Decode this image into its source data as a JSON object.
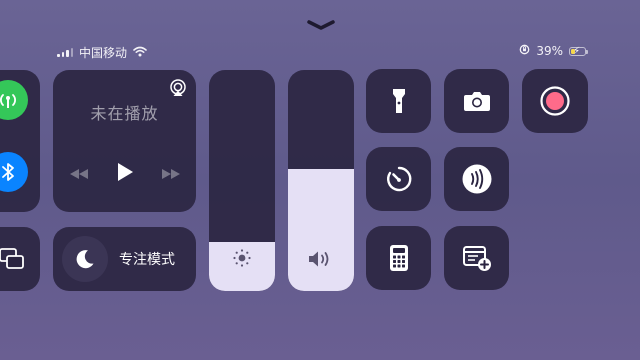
{
  "status_bar": {
    "carrier": "中国移动",
    "battery_percent": "39%",
    "battery_level": 0.39,
    "icons": [
      "signal-icon",
      "wifi-icon",
      "orientation-lock-icon",
      "battery-charging-icon"
    ]
  },
  "now_playing": {
    "title": "未在播放",
    "icons": [
      "airplay-icon",
      "rewind-icon",
      "play-icon",
      "fast-forward-icon"
    ]
  },
  "focus": {
    "label": "专注模式",
    "icon": "moon-icon"
  },
  "brightness": {
    "level": 0.22,
    "icon": "sun-icon"
  },
  "volume": {
    "level": 0.55,
    "icon": "speaker-icon"
  },
  "controls": [
    {
      "name": "flashlight",
      "icon": "flashlight-icon"
    },
    {
      "name": "camera",
      "icon": "camera-icon"
    },
    {
      "name": "screen-recording",
      "icon": "record-icon"
    },
    {
      "name": "timer",
      "icon": "timer-icon"
    },
    {
      "name": "nfc",
      "icon": "nfc-icon"
    },
    {
      "name": "calculator",
      "icon": "calculator-icon"
    },
    {
      "name": "quick-note",
      "icon": "note-add-icon"
    }
  ],
  "colors": {
    "cellular_green": "#34c759",
    "bluetooth_blue": "#0a84ff",
    "tile_bg": "#28223c",
    "slider_fill": "#e5e0f5",
    "record_red": "#ff6b8a"
  }
}
